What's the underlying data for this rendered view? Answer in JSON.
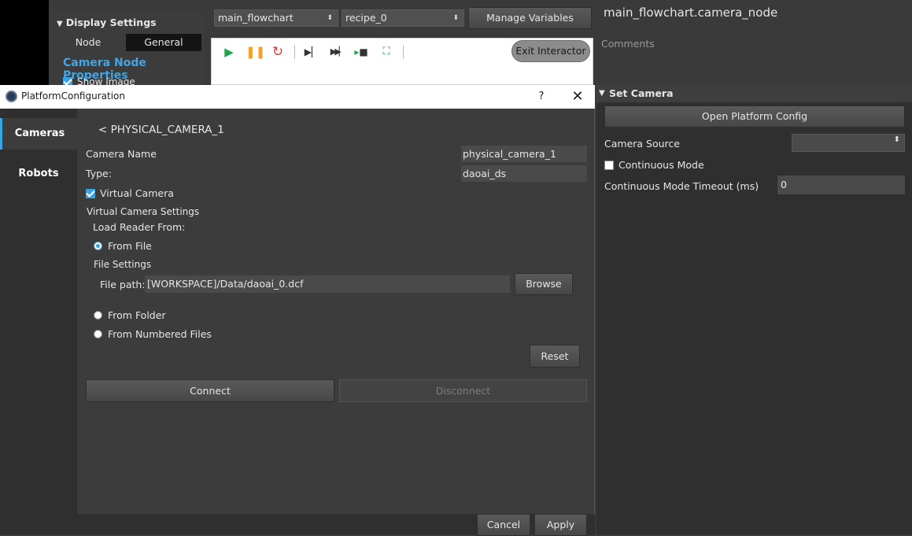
{
  "display_settings": {
    "title": "Display Settings",
    "tabs": [
      "Node",
      "General"
    ],
    "section_title": "Camera Node Properties",
    "show_image_label": "Show Image"
  },
  "top_bar": {
    "flowchart_value": "main_flowchart",
    "recipe_value": "recipe_0",
    "manage_variables_label": "Manage Variables",
    "exit_interactor_label": "Exit Interactor",
    "toolbar_icons": [
      "play-icon",
      "pause-icon",
      "reload-icon",
      "step-icon",
      "fast-forward-icon",
      "run-to-icon",
      "flowchart-icon"
    ],
    "colors": {
      "play": "#1aa84b",
      "pause": "#f2a12b",
      "reload": "#e33b2e"
    }
  },
  "node_panel": {
    "title": "main_flowchart.camera_node",
    "comments_label": "Comments",
    "section_title": "Set Camera",
    "open_platform_label": "Open Platform Config",
    "camera_source_label": "Camera Source",
    "camera_source_value": "",
    "continuous_mode_label": "Continuous Mode",
    "continuous_mode_checked": false,
    "timeout_label": "Continuous Mode Timeout (ms)",
    "timeout_value": "0"
  },
  "dialog": {
    "title": "PlatformConfiguration",
    "help_label": "?",
    "close_label": "✕",
    "sidebar": [
      "Cameras",
      "Robots"
    ],
    "back_label": "<  PHYSICAL_CAMERA_1",
    "camera_name_label": "Camera Name",
    "camera_name_value": "physical_camera_1",
    "type_label": "Type:",
    "type_value": "daoai_ds",
    "virtual_camera_label": "Virtual Camera",
    "virtual_camera_checked": true,
    "virtual_settings_label": "Virtual Camera Settings",
    "load_reader_label": "Load Reader From:",
    "from_file_label": "From File",
    "file_settings_label": "File Settings",
    "file_path_label": "File path:",
    "file_path_value": "[WORKSPACE]/Data/daoai_0.dcf",
    "browse_label": "Browse",
    "from_folder_label": "From Folder",
    "from_numbered_label": "From Numbered Files",
    "reset_label": "Reset",
    "connect_label": "Connect",
    "disconnect_label": "Disconnect",
    "cancel_label": "Cancel",
    "apply_label": "Apply",
    "accent_color": "#3aa3e3"
  }
}
